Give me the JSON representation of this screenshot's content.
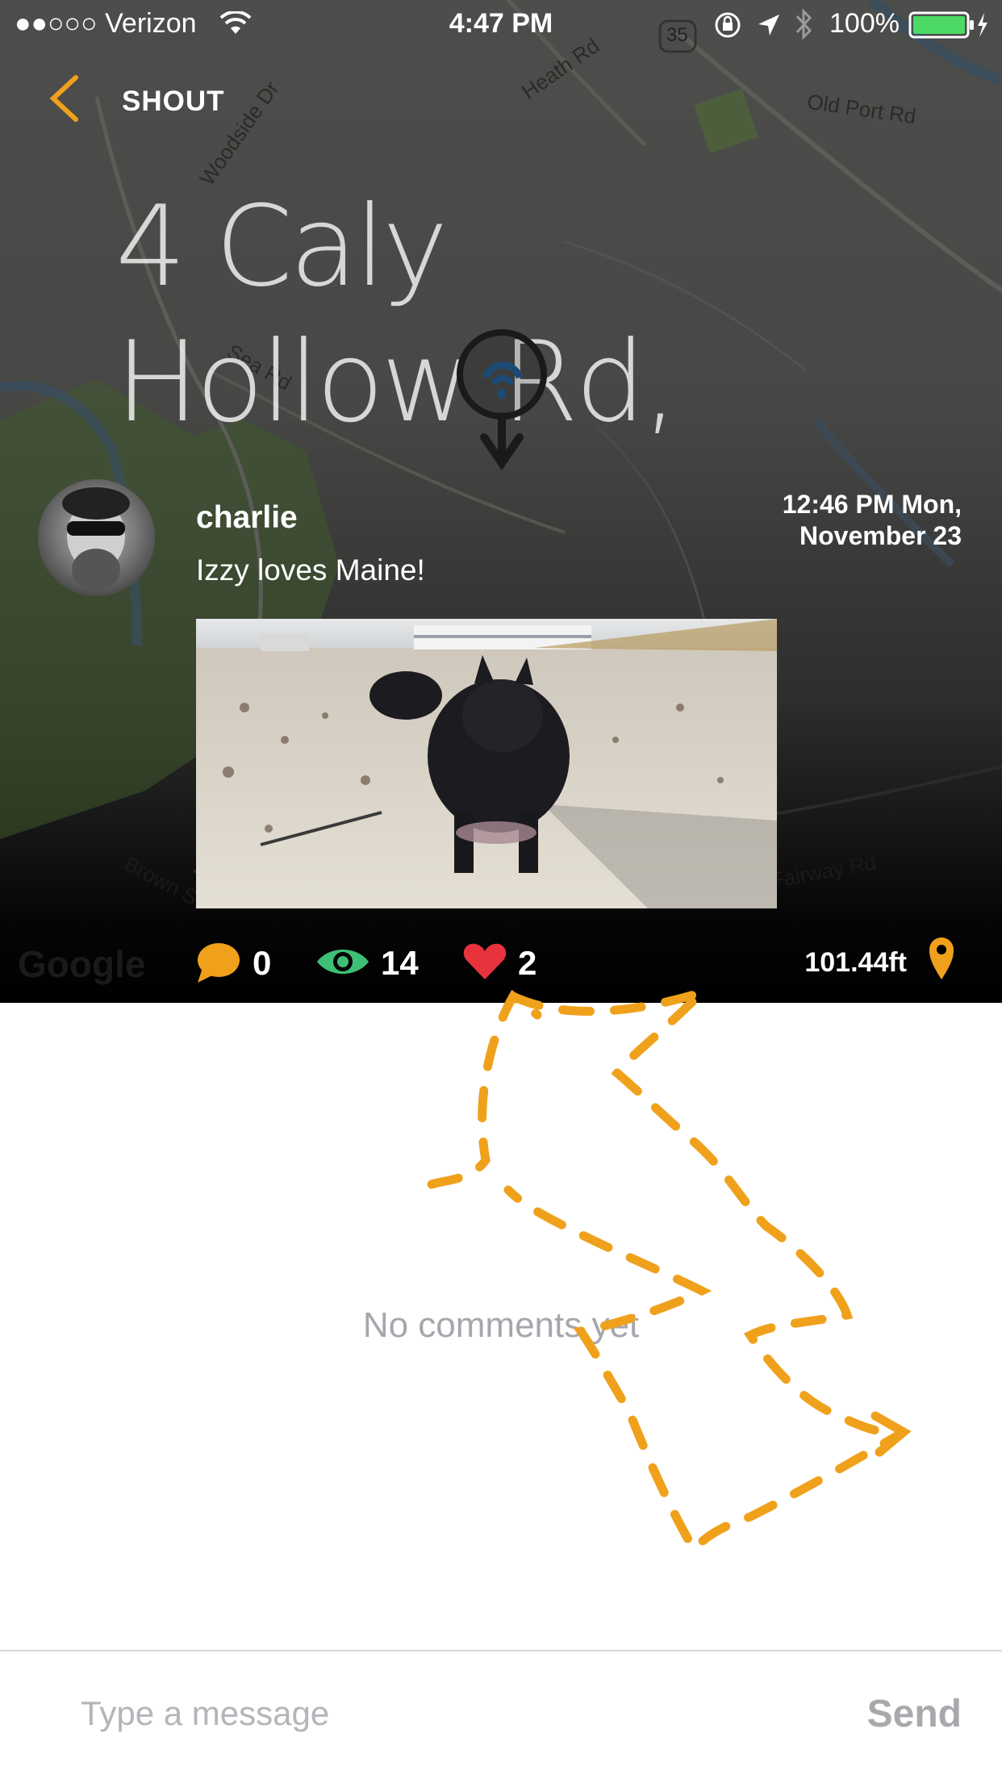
{
  "status_bar": {
    "carrier": "●●○○○ Verizon",
    "time": "4:47 PM",
    "battery": "100%"
  },
  "map": {
    "street_labels": [
      "Woodside Dr",
      "Heath Rd",
      "Old Port Rd",
      "Sea Rd",
      "Brown St",
      "Fairway Rd",
      "35",
      "Google"
    ]
  },
  "header": {
    "title": "SHOUT",
    "back_icon": "chevron-left-icon"
  },
  "location": {
    "address": "4 Caly Hollow Rd,"
  },
  "post": {
    "username": "charlie",
    "text": "Izzy loves Maine!",
    "timestamp_line1": "12:46 PM Mon,",
    "timestamp_line2": "November 23"
  },
  "stats": {
    "comments": "0",
    "views": "14",
    "likes": "2",
    "distance": "101.44ft"
  },
  "comments": {
    "empty_text": "No comments yet"
  },
  "composer": {
    "placeholder": "Type a message",
    "send_label": "Send"
  },
  "colors": {
    "accent": "#f0a11b",
    "views": "#3fbf75",
    "likes": "#e8323c",
    "scribble": "#f0a11b"
  }
}
